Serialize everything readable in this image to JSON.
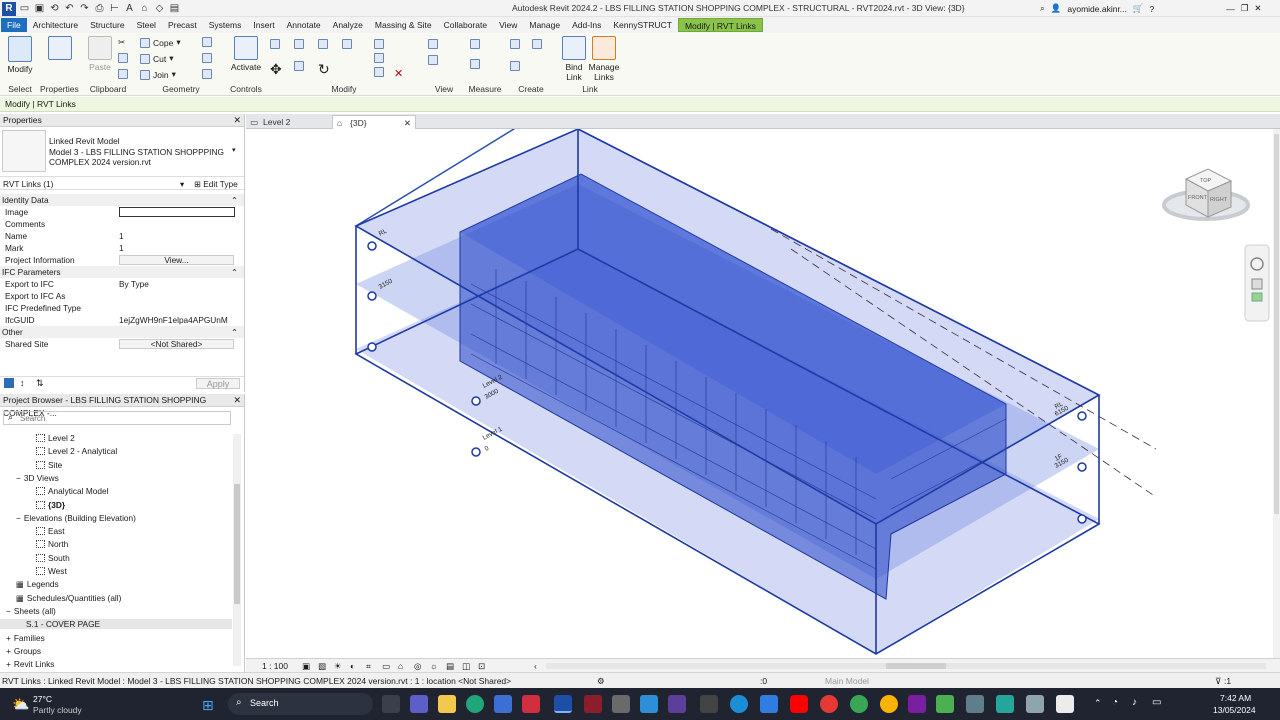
{
  "app": {
    "title": "Autodesk Revit 2024.2 - LBS FILLING STATION SHOPPING COMPLEX - STRUCTURAL - RVT2024.rvt - 3D View: {3D}",
    "user": "ayomide.akinr...",
    "logo": "R"
  },
  "menu": [
    "File",
    "Architecture",
    "Structure",
    "Steel",
    "Precast",
    "Systems",
    "Insert",
    "Annotate",
    "Analyze",
    "Massing & Site",
    "Collaborate",
    "View",
    "Manage",
    "Add-Ins",
    "KennySTRUCT",
    "Modify | RVT Links"
  ],
  "ribbon": {
    "modify": "Modify",
    "properties": "Properties",
    "activate": "Activate",
    "cope": "Cope",
    "cut": "Cut",
    "join": "Join",
    "paste": "Paste",
    "bind_link": "Bind Link",
    "manage_links": "Manage Links",
    "groups": {
      "select": "Select",
      "properties": "Properties",
      "clipboard": "Clipboard",
      "geometry": "Geometry",
      "controls": "Controls",
      "modify": "Modify",
      "view": "View",
      "measure": "Measure",
      "create": "Create",
      "link": "Link"
    }
  },
  "context_label": "Modify | RVT Links",
  "properties": {
    "title": "Properties",
    "type_line1": "Linked Revit Model",
    "type_line2": "Model 3 - LBS FILLING STATION SHOPPPING",
    "type_line3": "COMPLEX 2024 version.rvt",
    "selector": "RVT Links (1)",
    "edit_type": "Edit Type",
    "apply": "Apply",
    "rows": [
      {
        "section": "Identity Data"
      },
      {
        "k": "Image",
        "v": ""
      },
      {
        "k": "Comments",
        "v": ""
      },
      {
        "k": "Name",
        "v": "1"
      },
      {
        "k": "Mark",
        "v": "1"
      },
      {
        "k": "Project Information",
        "v": "View..."
      },
      {
        "section": "IFC Parameters"
      },
      {
        "k": "Export to IFC",
        "v": "By Type"
      },
      {
        "k": "Export to IFC As",
        "v": ""
      },
      {
        "k": "IFC Predefined Type",
        "v": ""
      },
      {
        "k": "IfcGUID",
        "v": "1ejZgWH9nF1elpa4APGUnM"
      },
      {
        "section": "Other"
      },
      {
        "k": "Shared Site",
        "v": "<Not Shared>"
      }
    ]
  },
  "browser": {
    "title": "Project Browser - LBS FILLING STATION SHOPPING COMPLEX -...",
    "search_placeholder": "Search",
    "items": [
      {
        "label": "Level 2",
        "indent": 3,
        "icon": "view"
      },
      {
        "label": "Level 2 - Analytical",
        "indent": 3,
        "icon": "view"
      },
      {
        "label": "Site",
        "indent": 3,
        "icon": "view"
      },
      {
        "label": "3D Views",
        "indent": 1,
        "icon": "minus"
      },
      {
        "label": "Analytical Model",
        "indent": 3,
        "icon": "view"
      },
      {
        "label": "{3D}",
        "indent": 3,
        "icon": "view",
        "bold": true
      },
      {
        "label": "Elevations (Building Elevation)",
        "indent": 1,
        "icon": "minus"
      },
      {
        "label": "East",
        "indent": 3,
        "icon": "view"
      },
      {
        "label": "North",
        "indent": 3,
        "icon": "view"
      },
      {
        "label": "South",
        "indent": 3,
        "icon": "view"
      },
      {
        "label": "West",
        "indent": 3,
        "icon": "view"
      },
      {
        "label": "Legends",
        "indent": 1,
        "icon": "grid"
      },
      {
        "label": "Schedules/Quantities (all)",
        "indent": 1,
        "icon": "grid"
      },
      {
        "label": "Sheets (all)",
        "indent": 0,
        "icon": "minus"
      },
      {
        "label": "S.1 - COVER PAGE",
        "indent": 2,
        "icon": "none",
        "selected": true
      },
      {
        "label": "Families",
        "indent": 0,
        "icon": "plus"
      },
      {
        "label": "Groups",
        "indent": 0,
        "icon": "plus"
      },
      {
        "label": "Revit Links",
        "indent": 0,
        "icon": "plus"
      }
    ]
  },
  "tabs": [
    {
      "label": "Level 2",
      "active": false
    },
    {
      "label": "{3D}",
      "active": true
    }
  ],
  "levels": {
    "top_tag": "RL",
    "l2": "Level 2",
    "l2_elev": "3000",
    "l1": "Level 1",
    "l1_elev": "0",
    "mid_tag": "1F",
    "mid_elev": "3150",
    "right_tag1": "RL",
    "right_val1": "6150",
    "right_tag2": "1F",
    "right_val2": "3150"
  },
  "viewcube": {
    "top": "TOP",
    "front": "FRONT",
    "right": "RIGHT"
  },
  "viewbar": {
    "scale": "1 : 100"
  },
  "status": {
    "text": "RVT Links : Linked Revit Model : Model 3 - LBS FILLING STATION SHOPPING COMPLEX 2024 version.rvt : 1 : location <Not Shared>",
    "model": "Main Model",
    "zero": ":0",
    "filter": ":1"
  },
  "taskbar": {
    "temp": "27°C",
    "weather": "Partly cloudy",
    "search": "Search",
    "time": "7:42 AM",
    "date": "13/05/2024"
  }
}
